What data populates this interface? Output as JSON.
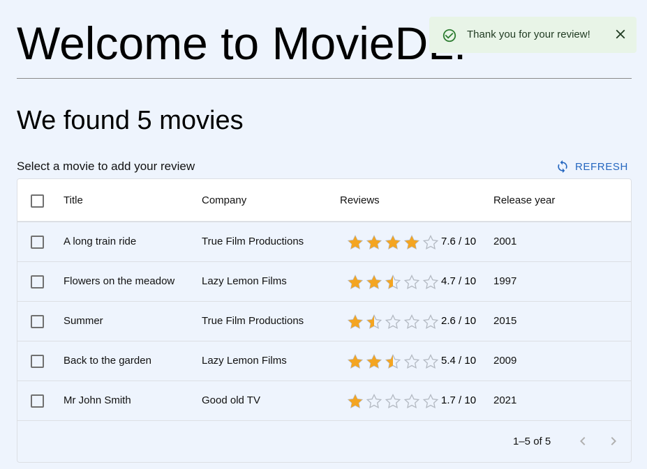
{
  "page": {
    "title": "Welcome to MovieDL!",
    "subtitle": "We found 5 movies",
    "instruction": "Select a movie to add your review"
  },
  "toolbar": {
    "refresh_label": "REFRESH",
    "refresh_icon": "refresh-icon"
  },
  "toast": {
    "message": "Thank you for your review!",
    "icon": "check-circle-icon",
    "close_icon": "close-icon",
    "color": "#e8f4e7"
  },
  "table": {
    "columns": [
      "Title",
      "Company",
      "Reviews",
      "Release year"
    ],
    "rows": [
      {
        "title": "A long train ride",
        "company": "True Film Productions",
        "stars": 4,
        "rating": "7.6 / 10",
        "year": "2001"
      },
      {
        "title": "Flowers on the meadow",
        "company": "Lazy Lemon Films",
        "stars": 2.5,
        "rating": "4.7 / 10",
        "year": "1997"
      },
      {
        "title": "Summer",
        "company": "True Film Productions",
        "stars": 1.5,
        "rating": "2.6 / 10",
        "year": "2015"
      },
      {
        "title": "Back to the garden",
        "company": "Lazy Lemon Films",
        "stars": 2.5,
        "rating": "5.4 / 10",
        "year": "2009"
      },
      {
        "title": "Mr John Smith",
        "company": "Good old TV",
        "stars": 1,
        "rating": "1.7 / 10",
        "year": "2021"
      }
    ]
  },
  "pagination": {
    "range": "1–5 of 5",
    "prev_icon": "chevron-left-icon",
    "next_icon": "chevron-right-icon"
  },
  "colors": {
    "accent": "#2567c0",
    "star": "#f4a521",
    "background": "#eef4fd"
  }
}
